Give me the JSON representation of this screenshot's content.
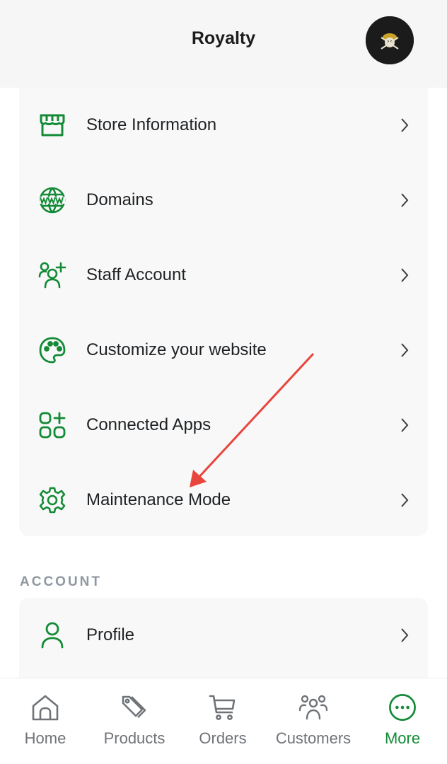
{
  "header": {
    "title": "Royalty",
    "avatar_icon": "one-piece-skull-avatar",
    "avatar_text": "NE PIEC"
  },
  "colors": {
    "accent_green": "#138a36",
    "nav_gray": "#6f7378",
    "section_gray": "#8f97a0",
    "annotation_red": "#e8453c"
  },
  "settings_menu": {
    "items": [
      {
        "icon": "store-icon",
        "label": "Store Information"
      },
      {
        "icon": "globe-www-icon",
        "label": "Domains"
      },
      {
        "icon": "add-user-icon",
        "label": "Staff Account"
      },
      {
        "icon": "palette-icon",
        "label": "Customize your website"
      },
      {
        "icon": "apps-add-icon",
        "label": "Connected Apps"
      },
      {
        "icon": "gear-icon",
        "label": "Maintenance Mode"
      }
    ]
  },
  "account_section": {
    "title": "ACCOUNT",
    "items": [
      {
        "icon": "user-icon",
        "label": "Profile"
      }
    ]
  },
  "bottom_nav": {
    "items": [
      {
        "icon": "home-icon",
        "label": "Home",
        "active": false
      },
      {
        "icon": "tag-icon",
        "label": "Products",
        "active": false
      },
      {
        "icon": "cart-icon",
        "label": "Orders",
        "active": false
      },
      {
        "icon": "users-icon",
        "label": "Customers",
        "active": false
      },
      {
        "icon": "more-icon",
        "label": "More",
        "active": true
      }
    ]
  }
}
